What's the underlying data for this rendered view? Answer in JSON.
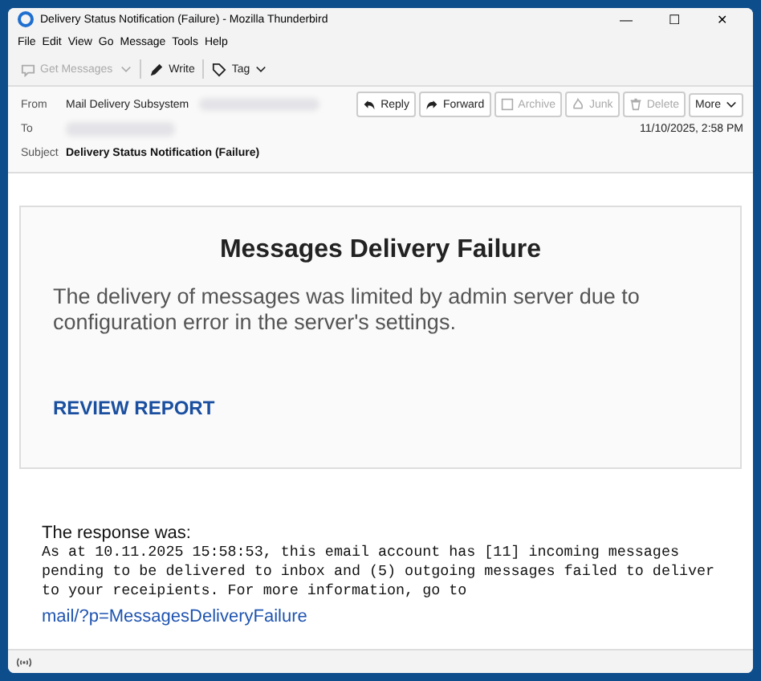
{
  "window": {
    "title": "Delivery Status Notification (Failure) - Mozilla Thunderbird",
    "controls": [
      "—",
      "☐",
      "✕"
    ]
  },
  "menu": [
    "File",
    "Edit",
    "View",
    "Go",
    "Message",
    "Tools",
    "Help"
  ],
  "toolbar": [
    {
      "kind": "get",
      "label": "Get Messages",
      "disabled": true
    },
    {
      "kind": "write",
      "label": "Write",
      "disabled": false
    },
    {
      "kind": "tag",
      "label": "Tag",
      "disabled": false
    }
  ],
  "header": {
    "from_label": "From",
    "from": "Mail Delivery Subsystem",
    "to_label": "To",
    "date": "11/10/2025, 2:58 PM",
    "subject_label": "Subject",
    "subject": "Delivery Status Notification (Failure)"
  },
  "actions": [
    {
      "kind": "reply",
      "label": "Reply",
      "disabled": false
    },
    {
      "kind": "forward",
      "label": "Forward",
      "disabled": false
    },
    {
      "kind": "archive",
      "label": "Archive",
      "disabled": true
    },
    {
      "kind": "junk",
      "label": "Junk",
      "disabled": true
    },
    {
      "kind": "delete",
      "label": "Delete",
      "disabled": true
    },
    {
      "kind": "more",
      "label": "More",
      "disabled": false
    }
  ],
  "card": {
    "heading": "Messages Delivery Failure",
    "text": "The delivery of messages was limited by admin server due to configuration error in the server's settings.",
    "link": "REVIEW REPORT"
  },
  "response": {
    "label": "The response was:",
    "text": "As at 10.11.2025 15:58:53, this email account has [11] incoming messages pending to be delivered to inbox and (5) outgoing messages failed to deliver to your receipients. For more information, go to",
    "link": "mail/?p=MessagesDeliveryFailure"
  }
}
